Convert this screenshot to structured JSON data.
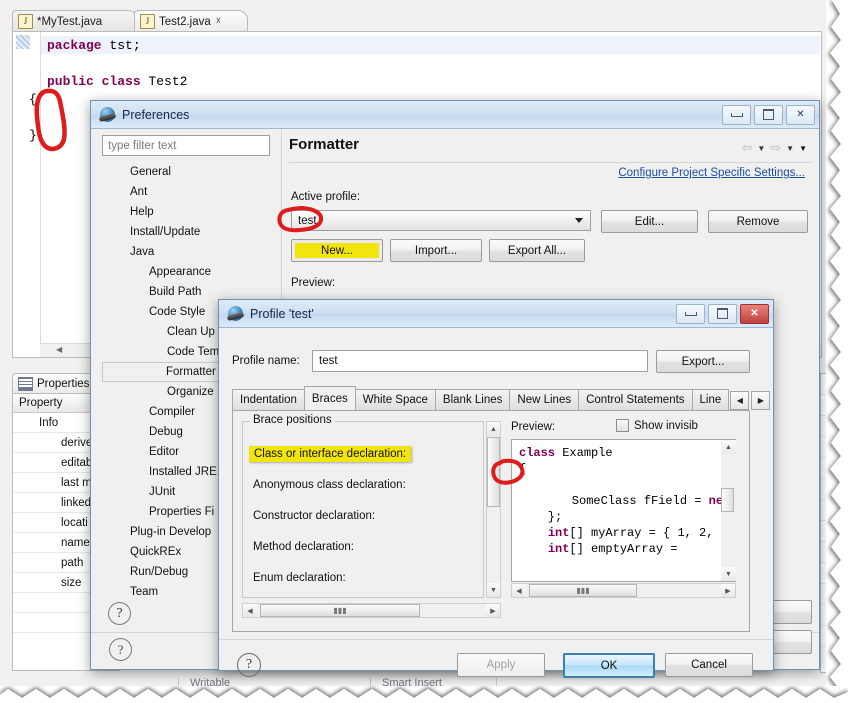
{
  "editor": {
    "tabs": [
      {
        "label": "*MyTest.java",
        "icon": "java-file-icon",
        "active": false,
        "closable": false
      },
      {
        "label": "Test2.java",
        "icon": "java-file-icon",
        "active": true,
        "closable": true
      }
    ],
    "code": [
      {
        "text": "package tst;",
        "kw": "package"
      },
      {
        "text": "public class Test2",
        "kw": "public class"
      },
      {
        "text": "{",
        "kw": ""
      },
      {
        "text": "}",
        "kw": ""
      }
    ],
    "line1_keyword": "package",
    "line1_rest": " tst;",
    "line2_keyword": "public class",
    "line2_rest": " Test2",
    "line3": "{",
    "line4": "}"
  },
  "properties_view": {
    "tab_label": "Properties",
    "column_header": "Property",
    "rows": [
      "Info",
      "derive",
      "editab",
      "last m",
      "linked",
      "locati",
      "name",
      "path",
      "size"
    ]
  },
  "statusbar": {
    "writable": "Writable",
    "insert_mode": "Smart Insert"
  },
  "preferences": {
    "title": "Preferences",
    "filter_placeholder": "type filter text",
    "window_buttons": {
      "minimize": "minimize",
      "maximize": "maximize",
      "close": "close"
    },
    "tree": [
      {
        "label": "General",
        "indent": 0,
        "selected": false
      },
      {
        "label": "Ant",
        "indent": 0,
        "selected": false
      },
      {
        "label": "Help",
        "indent": 0,
        "selected": false
      },
      {
        "label": "Install/Update",
        "indent": 0,
        "selected": false
      },
      {
        "label": "Java",
        "indent": 0,
        "selected": false
      },
      {
        "label": "Appearance",
        "indent": 1,
        "selected": false
      },
      {
        "label": "Build Path",
        "indent": 1,
        "selected": false
      },
      {
        "label": "Code Style",
        "indent": 1,
        "selected": false
      },
      {
        "label": "Clean Up",
        "indent": 2,
        "selected": false
      },
      {
        "label": "Code Tem",
        "indent": 2,
        "selected": false
      },
      {
        "label": "Formatter",
        "indent": 2,
        "selected": true
      },
      {
        "label": "Organize",
        "indent": 2,
        "selected": false
      },
      {
        "label": "Compiler",
        "indent": 1,
        "selected": false
      },
      {
        "label": "Debug",
        "indent": 1,
        "selected": false
      },
      {
        "label": "Editor",
        "indent": 1,
        "selected": false
      },
      {
        "label": "Installed JRE",
        "indent": 1,
        "selected": false
      },
      {
        "label": "JUnit",
        "indent": 1,
        "selected": false
      },
      {
        "label": "Properties Fi",
        "indent": 1,
        "selected": false
      },
      {
        "label": "Plug-in Develop",
        "indent": 0,
        "selected": false
      },
      {
        "label": "QuickREx",
        "indent": 0,
        "selected": false
      },
      {
        "label": "Run/Debug",
        "indent": 0,
        "selected": false
      },
      {
        "label": "Team",
        "indent": 0,
        "selected": false
      }
    ],
    "page_title": "Formatter",
    "project_settings_link": "Configure Project Specific Settings...",
    "active_profile_label": "Active profile:",
    "active_profile_value": "test",
    "buttons": {
      "edit": "Edit...",
      "remove": "Remove",
      "new": "New...",
      "import": "Import...",
      "export_all": "Export All..."
    },
    "preview_label": "Preview:",
    "help_icon": "question-mark-icon"
  },
  "profile_dialog": {
    "title": "Profile 'test'",
    "profile_name_label": "Profile name:",
    "profile_name_value": "test",
    "export_button": "Export...",
    "tabs": [
      {
        "label": "Indentation",
        "active": false
      },
      {
        "label": "Braces",
        "active": true
      },
      {
        "label": "White Space",
        "active": false
      },
      {
        "label": "Blank Lines",
        "active": false
      },
      {
        "label": "New Lines",
        "active": false
      },
      {
        "label": "Control Statements",
        "active": false
      },
      {
        "label": "Line",
        "active": false
      }
    ],
    "tab_scroll_left": "◀",
    "tab_scroll_right": "▶",
    "group_legend": "Brace positions",
    "brace_items": [
      {
        "label": "Class or interface declaration:",
        "highlighted": true
      },
      {
        "label": "Anonymous class declaration:",
        "highlighted": false
      },
      {
        "label": "Constructor declaration:",
        "highlighted": false
      },
      {
        "label": "Method declaration:",
        "highlighted": false
      },
      {
        "label": "Enum declaration:",
        "highlighted": false
      }
    ],
    "preview_label": "Preview:",
    "show_invisible_label": "Show invisib",
    "show_invisible_checked": false,
    "preview_code": [
      {
        "text": "class Example",
        "kw": "class",
        "rest": " Example"
      },
      {
        "text": "{",
        "kw": "",
        "rest": "{"
      },
      {
        "text": "",
        "kw": "",
        "rest": ""
      },
      {
        "text": "    SomeClass fField = new",
        "kw": "new",
        "rest": "    SomeClass fField = "
      },
      {
        "text": "    };",
        "kw": "",
        "rest": "    };"
      },
      {
        "text": "    int[] myArray = { 1, 2,",
        "kw": "int",
        "rest": "[] myArray = { 1, 2,"
      },
      {
        "text": "    int[] emptyArray = new",
        "kw": "int",
        "rest": "[] emptyArray = "
      }
    ],
    "buttons": {
      "apply": "Apply",
      "ok": "OK",
      "cancel": "Cancel"
    },
    "apply_disabled": true,
    "help_icon": "question-mark-icon",
    "window_buttons": {
      "minimize": "minimize",
      "maximize": "maximize",
      "close": "close"
    }
  },
  "annotations": {
    "color": "#e01b1b",
    "marks": [
      {
        "name": "editor-braces-circle"
      },
      {
        "name": "active-profile-circle"
      },
      {
        "name": "new-button-highlight"
      },
      {
        "name": "class-declaration-highlight"
      },
      {
        "name": "preview-brace-circle"
      }
    ]
  },
  "colors": {
    "keyword": "#7f0055",
    "highlight_yellow": "#f2e50b",
    "link_blue": "#1a4f9c",
    "annotation_red": "#e01b1b"
  }
}
